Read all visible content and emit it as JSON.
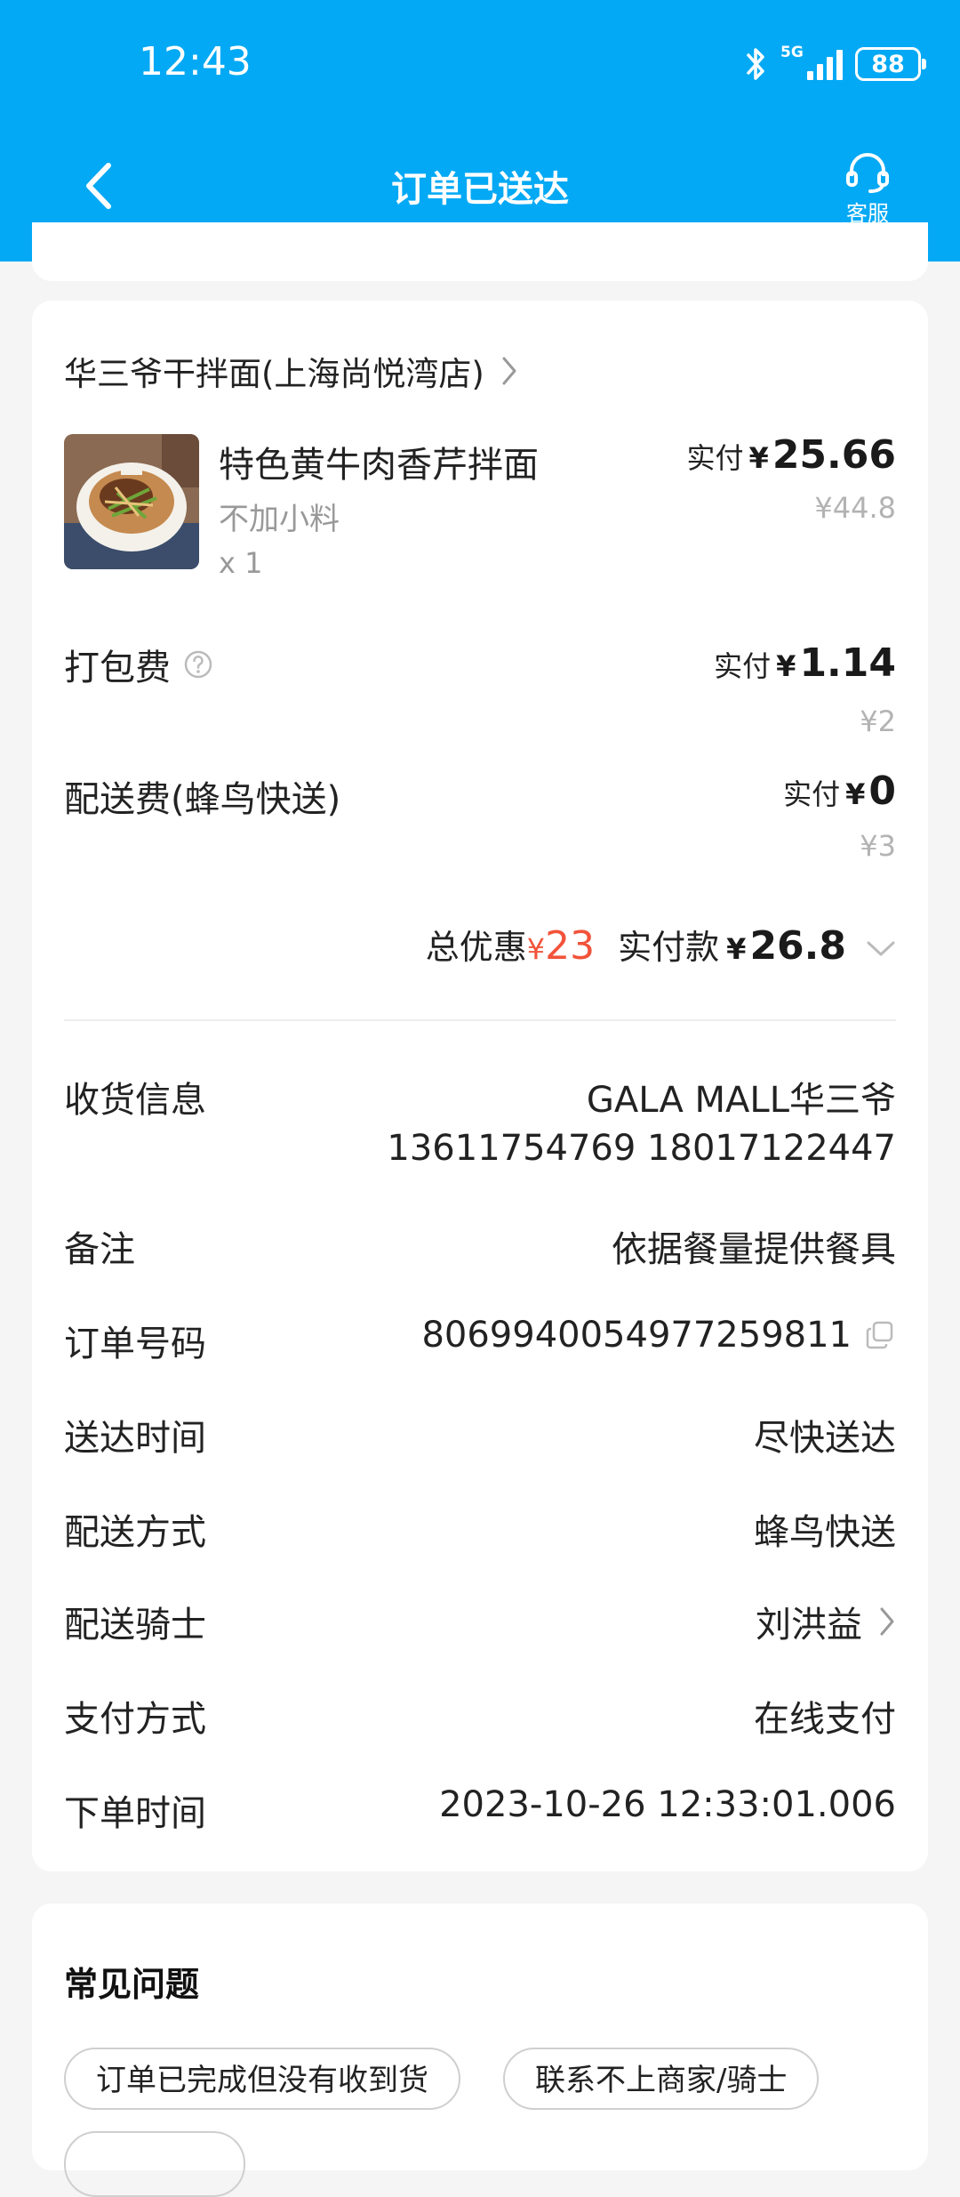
{
  "status_bar": {
    "time": "12:43",
    "network": "5G",
    "battery": "88"
  },
  "header": {
    "title": "订单已送达",
    "service_label": "客服"
  },
  "shop": {
    "name": "华三爷干拌面(上海尚悦湾店)"
  },
  "item": {
    "name": "特色黄牛肉香芹拌面",
    "spec": "不加小料",
    "qty": "x 1",
    "pay_label": "实付",
    "currency": "¥",
    "paid": "25.66",
    "original": "¥44.8"
  },
  "fees": {
    "packing": {
      "label": "打包费",
      "pay_label": "实付",
      "currency": "¥",
      "paid": "1.14",
      "original": "¥2"
    },
    "delivery": {
      "label": "配送费(蜂鸟快送)",
      "pay_label": "实付",
      "currency": "¥",
      "paid": "0",
      "original": "¥3"
    }
  },
  "summary": {
    "discount_label": "总优惠",
    "discount_currency": "¥",
    "discount_value": "23",
    "paid_label": "实付款",
    "paid_currency": "¥",
    "paid_value": "26.8"
  },
  "info": {
    "receiver": {
      "label": "收货信息",
      "value": "GALA MALL华三爷",
      "phones": "13611754769 18017122447"
    },
    "remark": {
      "label": "备注",
      "value": "依据餐量提供餐具"
    },
    "order_no": {
      "label": "订单号码",
      "value": "8069940054977259811"
    },
    "delivery_time": {
      "label": "送达时间",
      "value": "尽快送达"
    },
    "delivery_method": {
      "label": "配送方式",
      "value": "蜂鸟快送"
    },
    "rider": {
      "label": "配送骑士",
      "value": "刘洪益"
    },
    "payment": {
      "label": "支付方式",
      "value": "在线支付"
    },
    "order_time": {
      "label": "下单时间",
      "value": "2023-10-26 12:33:01.006"
    }
  },
  "faq": {
    "title": "常见问题",
    "items": [
      "订单已完成但没有收到货",
      "联系不上商家/骑士"
    ]
  },
  "colors": {
    "header_bg": "#03a9f4",
    "discount": "#f2533a"
  }
}
